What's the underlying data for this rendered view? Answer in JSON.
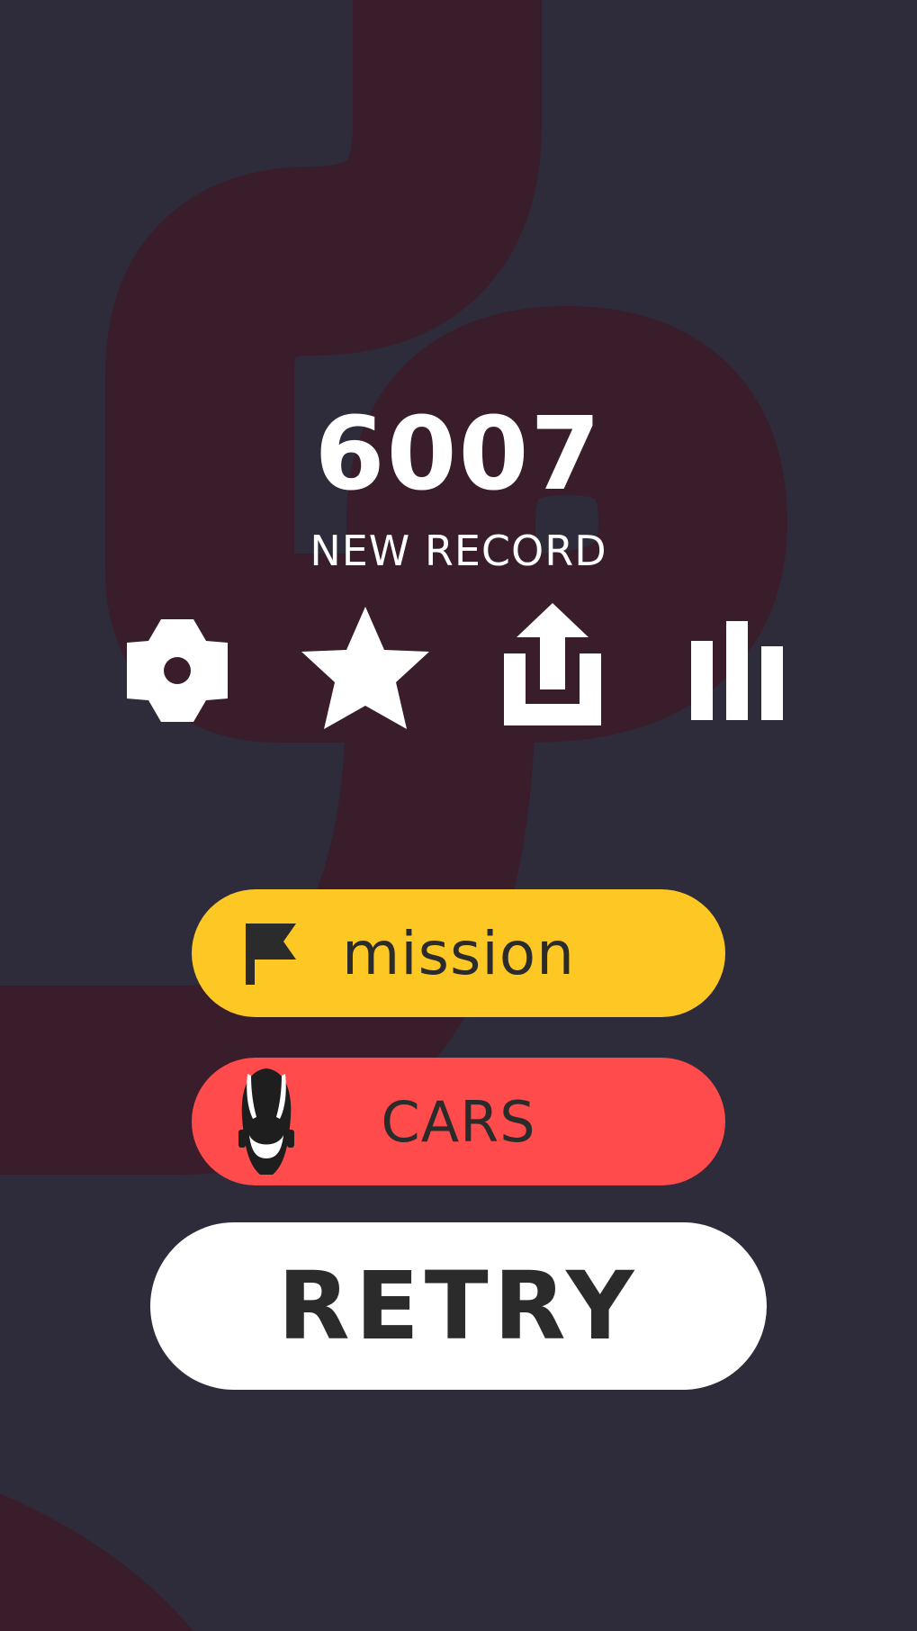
{
  "score": {
    "value": "6007",
    "label": "NEW RECORD"
  },
  "icon_row": [
    {
      "name": "settings",
      "icon": "gear-icon"
    },
    {
      "name": "rate",
      "icon": "star-icon"
    },
    {
      "name": "share",
      "icon": "share-icon"
    },
    {
      "name": "leaderboard",
      "icon": "bar-chart-icon"
    }
  ],
  "buttons": {
    "mission": {
      "label": "mission",
      "icon": "flag-icon",
      "color": "#fdc823"
    },
    "cars": {
      "label": "CARS",
      "icon": "car-icon",
      "color": "#ff4b4b"
    },
    "retry": {
      "label": "RETRY",
      "color": "#ffffff"
    }
  },
  "colors": {
    "background": "#2e2b3b",
    "track": "#3a1d2a",
    "text_light": "#ffffff",
    "text_dark": "#2b2b2b"
  }
}
